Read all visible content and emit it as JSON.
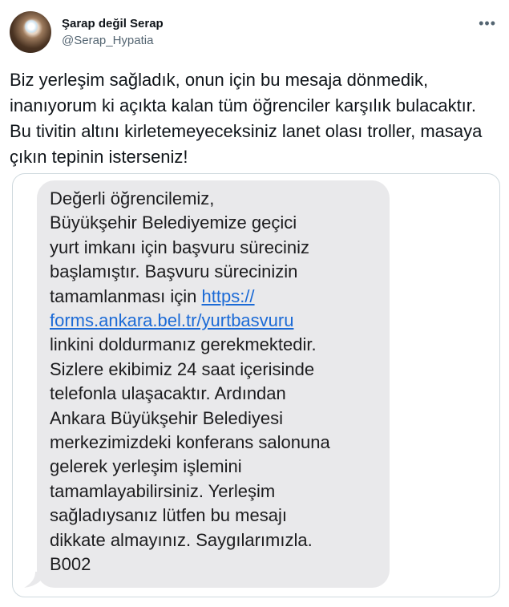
{
  "tweet": {
    "author": {
      "display_name": "Şarap değil Serap",
      "handle": "@Serap_Hypatia"
    },
    "more_icon": "more-horizontal-icon",
    "text": "Biz yerleşim sağladık, onun için bu mesaja dönmedik, inanıyorum ki açıkta kalan tüm öğrenciler karşılık bulacaktır. Bu tivitin altını kirletemeyeceksiniz lanet olası troller, masaya çıkın tepinin isterseniz!",
    "media": {
      "sms": {
        "text_before": "Değerli öğrencilemiz,\nBüyükşehir Belediyemize geçici\nyurt imkanı için başvuru süreciniz\nbaşlamıştır. Başvuru sürecinizin\ntamamlanması için ",
        "link_line1": "https://",
        "link_line2": "forms.ankara.bel.tr/yurtbasvuru",
        "text_after": "linkini doldurmanız gerekmektedir.\nSizlere ekibimiz 24 saat içerisinde\ntelefonla ulaşacaktır. Ardından\nAnkara Büyükşehir Belediyesi\nmerkezimizdeki konferans salonuna\ngelerek yerleşim işlemini\ntamamlayabilirsiniz. Yerleşim\nsağladıysanız lütfen bu mesajı\ndikkate almayınız. Saygılarımızla.\nB002",
        "bubble_color": "#e9e9eb",
        "link_color": "#1b6ad6"
      }
    }
  }
}
